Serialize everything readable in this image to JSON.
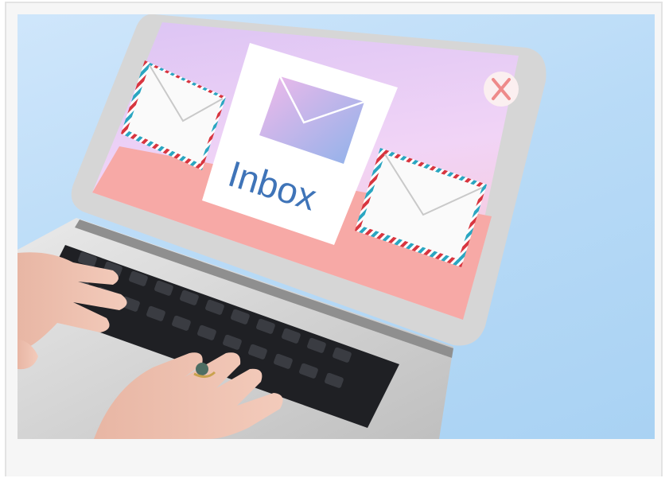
{
  "photo": {
    "screen_text": "Inbox",
    "close_glyph": "✕",
    "colors": {
      "background": "#b9dbf7",
      "screen_top": "#e7c8f5",
      "screen_band": "#f7a9a6",
      "laptop_body": "#d9d9d9",
      "envelope": "#c9a9ef",
      "inbox_text": "#3f74b8",
      "close_mark": "#ee8a8a"
    },
    "icons": [
      "envelope-icon",
      "close-icon",
      "envelope-icon",
      "envelope-icon"
    ]
  }
}
